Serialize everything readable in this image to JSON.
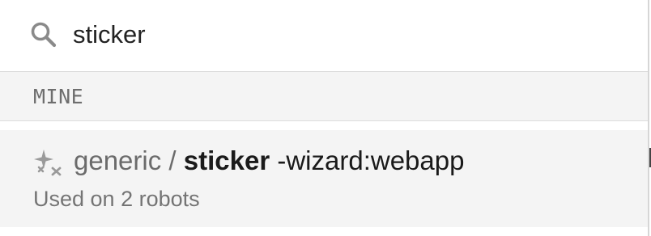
{
  "search": {
    "value": "sticker",
    "icon": "search-icon"
  },
  "section": {
    "header": "MINE"
  },
  "result": {
    "icon": "sparkle-icon",
    "namespace": "generic",
    "separator": " / ",
    "name": "sticker",
    "suffix": " -wizard:webapp",
    "subtitle": "Used on 2 robots"
  },
  "colors": {
    "panel_bg": "#ffffff",
    "header_bg": "#f4f4f4",
    "muted_text": "#6b6b6b",
    "strong_text": "#1a1a1a"
  }
}
